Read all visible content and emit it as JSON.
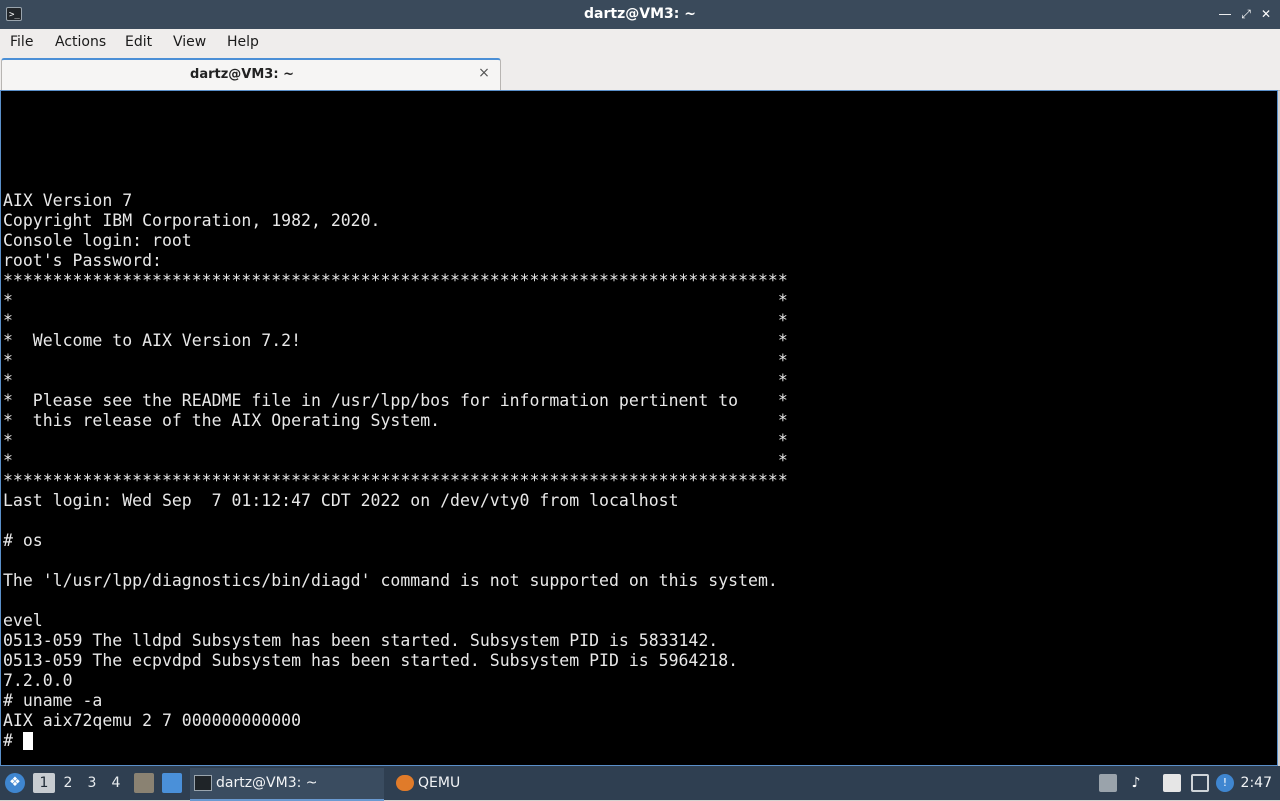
{
  "window": {
    "title": "dartz@VM3: ~"
  },
  "menu": {
    "items": [
      "File",
      "Actions",
      "Edit",
      "View",
      "Help"
    ]
  },
  "tab": {
    "label": "dartz@VM3: ~",
    "close": "×"
  },
  "terminal": {
    "lines": [
      "AIX Version 7",
      "Copyright IBM Corporation, 1982, 2020.",
      "Console login: root",
      "root's Password:",
      "*******************************************************************************",
      "*                                                                             *",
      "*                                                                             *",
      "*  Welcome to AIX Version 7.2!                                                *",
      "*                                                                             *",
      "*                                                                             *",
      "*  Please see the README file in /usr/lpp/bos for information pertinent to    *",
      "*  this release of the AIX Operating System.                                  *",
      "*                                                                             *",
      "*                                                                             *",
      "*******************************************************************************",
      "Last login: Wed Sep  7 01:12:47 CDT 2022 on /dev/vty0 from localhost",
      "",
      "# os",
      "",
      "The 'l/usr/lpp/diagnostics/bin/diagd' command is not supported on this system.",
      "",
      "evel",
      "0513-059 The lldpd Subsystem has been started. Subsystem PID is 5833142.",
      "0513-059 The ecpvdpd Subsystem has been started. Subsystem PID is 5964218.",
      "7.2.0.0",
      "# uname -a",
      "AIX aix72qemu 2 7 000000000000"
    ],
    "prompt": "# "
  },
  "taskbar": {
    "workspaces": [
      "1",
      "2",
      "3",
      "4"
    ],
    "active_workspace": "1",
    "tasks": [
      {
        "label": "dartz@VM3: ~",
        "icon": "terminal-icon",
        "active": true
      },
      {
        "label": "QEMU",
        "icon": "qemu-icon",
        "active": false
      }
    ],
    "clock": "2:47"
  },
  "colors": {
    "accent": "#4b8fd6",
    "titlebar": "#3a4a5b",
    "taskbar": "#2f3f51"
  }
}
